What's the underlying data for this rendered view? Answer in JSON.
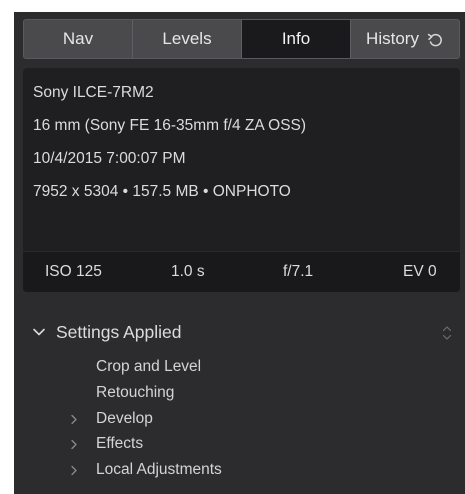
{
  "tabs": [
    {
      "label": "Nav",
      "active": false
    },
    {
      "label": "Levels",
      "active": false
    },
    {
      "label": "Info",
      "active": true
    },
    {
      "label": "History",
      "active": false,
      "icon": "undo-arrow-icon"
    }
  ],
  "info": {
    "camera": "Sony ILCE-7RM2",
    "lens": "16 mm (Sony FE 16-35mm f/4 ZA OSS)",
    "datetime": "10/4/2015 7:00:07 PM",
    "file_details": "7952 x 5304 • 157.5 MB • ONPHOTO"
  },
  "exif": {
    "iso": "ISO 125",
    "shutter": "1.0 s",
    "aperture": "f/7.1",
    "ev": "EV 0"
  },
  "settings": {
    "title": "Settings Applied",
    "expanded": true,
    "items": [
      {
        "label": "Crop and Level",
        "expandable": false
      },
      {
        "label": "Retouching",
        "expandable": false
      },
      {
        "label": "Develop",
        "expandable": true
      },
      {
        "label": "Effects",
        "expandable": true
      },
      {
        "label": "Local Adjustments",
        "expandable": true
      }
    ]
  },
  "colors": {
    "panel_bg": "#2c2c2e",
    "tab_bg": "#4a4a4d",
    "tab_active_bg": "#1a1a1c",
    "info_bg": "#1f1f21",
    "text": "#dcdcdc"
  }
}
